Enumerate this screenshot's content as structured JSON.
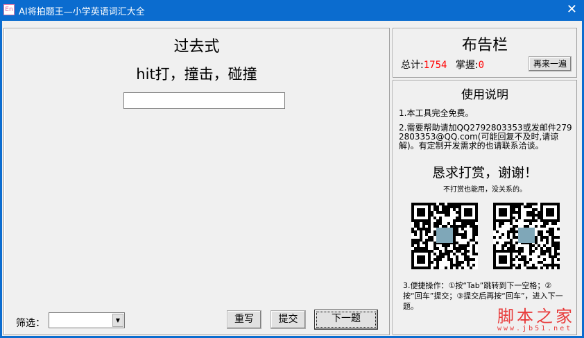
{
  "window": {
    "title": "AI将拍题王—小学英语词汇大全",
    "icon_text": "En",
    "close": "✕"
  },
  "main": {
    "tense": "过去式",
    "word": "hit打，撞击，碰撞",
    "answer_value": "",
    "filter_label": "筛选：",
    "filter_value": "",
    "rewrite": "重写",
    "submit": "提交",
    "next": "下一题"
  },
  "board": {
    "title": "布告栏",
    "total_label": "总计:",
    "total": "1754",
    "mastered_label": "掌握:",
    "mastered": "0",
    "again": "再来一遍"
  },
  "help": {
    "title": "使用说明",
    "item1": "1.本工具完全免费。",
    "item2": "2.需要帮助请加QQ2792803353或发邮件2792803353@QQ.com(可能回复不及时,请谅解)。有定制开发需求的也请联系洽谈。",
    "donate": "恳求打赏，谢谢！",
    "donate_sub": "不打赏也能用，没关系的。",
    "item3": "3.便捷操作：①按“Tab”跳转到下一空格；②按“回车”提交；③提交后再按“回车”，进入下一题。"
  },
  "watermark": {
    "name": "脚本之家",
    "url": "www.jb51.net"
  }
}
